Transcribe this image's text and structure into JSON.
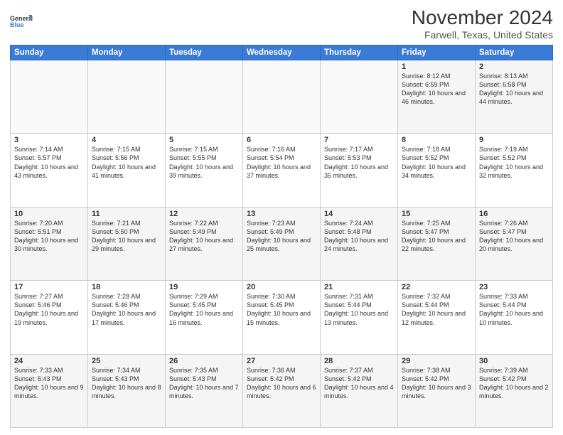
{
  "logo": {
    "line1": "General",
    "line2": "Blue"
  },
  "title": "November 2024",
  "subtitle": "Farwell, Texas, United States",
  "days_header": [
    "Sunday",
    "Monday",
    "Tuesday",
    "Wednesday",
    "Thursday",
    "Friday",
    "Saturday"
  ],
  "weeks": [
    [
      {
        "day": "",
        "info": ""
      },
      {
        "day": "",
        "info": ""
      },
      {
        "day": "",
        "info": ""
      },
      {
        "day": "",
        "info": ""
      },
      {
        "day": "",
        "info": ""
      },
      {
        "day": "1",
        "info": "Sunrise: 8:12 AM\nSunset: 6:59 PM\nDaylight: 10 hours\nand 46 minutes."
      },
      {
        "day": "2",
        "info": "Sunrise: 8:13 AM\nSunset: 6:58 PM\nDaylight: 10 hours\nand 44 minutes."
      }
    ],
    [
      {
        "day": "3",
        "info": "Sunrise: 7:14 AM\nSunset: 5:57 PM\nDaylight: 10 hours\nand 43 minutes."
      },
      {
        "day": "4",
        "info": "Sunrise: 7:15 AM\nSunset: 5:56 PM\nDaylight: 10 hours\nand 41 minutes."
      },
      {
        "day": "5",
        "info": "Sunrise: 7:15 AM\nSunset: 5:55 PM\nDaylight: 10 hours\nand 39 minutes."
      },
      {
        "day": "6",
        "info": "Sunrise: 7:16 AM\nSunset: 5:54 PM\nDaylight: 10 hours\nand 37 minutes."
      },
      {
        "day": "7",
        "info": "Sunrise: 7:17 AM\nSunset: 5:53 PM\nDaylight: 10 hours\nand 35 minutes."
      },
      {
        "day": "8",
        "info": "Sunrise: 7:18 AM\nSunset: 5:52 PM\nDaylight: 10 hours\nand 34 minutes."
      },
      {
        "day": "9",
        "info": "Sunrise: 7:19 AM\nSunset: 5:52 PM\nDaylight: 10 hours\nand 32 minutes."
      }
    ],
    [
      {
        "day": "10",
        "info": "Sunrise: 7:20 AM\nSunset: 5:51 PM\nDaylight: 10 hours\nand 30 minutes."
      },
      {
        "day": "11",
        "info": "Sunrise: 7:21 AM\nSunset: 5:50 PM\nDaylight: 10 hours\nand 29 minutes."
      },
      {
        "day": "12",
        "info": "Sunrise: 7:22 AM\nSunset: 5:49 PM\nDaylight: 10 hours\nand 27 minutes."
      },
      {
        "day": "13",
        "info": "Sunrise: 7:23 AM\nSunset: 5:49 PM\nDaylight: 10 hours\nand 25 minutes."
      },
      {
        "day": "14",
        "info": "Sunrise: 7:24 AM\nSunset: 5:48 PM\nDaylight: 10 hours\nand 24 minutes."
      },
      {
        "day": "15",
        "info": "Sunrise: 7:25 AM\nSunset: 5:47 PM\nDaylight: 10 hours\nand 22 minutes."
      },
      {
        "day": "16",
        "info": "Sunrise: 7:26 AM\nSunset: 5:47 PM\nDaylight: 10 hours\nand 20 minutes."
      }
    ],
    [
      {
        "day": "17",
        "info": "Sunrise: 7:27 AM\nSunset: 5:46 PM\nDaylight: 10 hours\nand 19 minutes."
      },
      {
        "day": "18",
        "info": "Sunrise: 7:28 AM\nSunset: 5:46 PM\nDaylight: 10 hours\nand 17 minutes."
      },
      {
        "day": "19",
        "info": "Sunrise: 7:29 AM\nSunset: 5:45 PM\nDaylight: 10 hours\nand 16 minutes."
      },
      {
        "day": "20",
        "info": "Sunrise: 7:30 AM\nSunset: 5:45 PM\nDaylight: 10 hours\nand 15 minutes."
      },
      {
        "day": "21",
        "info": "Sunrise: 7:31 AM\nSunset: 5:44 PM\nDaylight: 10 hours\nand 13 minutes."
      },
      {
        "day": "22",
        "info": "Sunrise: 7:32 AM\nSunset: 5:44 PM\nDaylight: 10 hours\nand 12 minutes."
      },
      {
        "day": "23",
        "info": "Sunrise: 7:33 AM\nSunset: 5:44 PM\nDaylight: 10 hours\nand 10 minutes."
      }
    ],
    [
      {
        "day": "24",
        "info": "Sunrise: 7:33 AM\nSunset: 5:43 PM\nDaylight: 10 hours\nand 9 minutes."
      },
      {
        "day": "25",
        "info": "Sunrise: 7:34 AM\nSunset: 5:43 PM\nDaylight: 10 hours\nand 8 minutes."
      },
      {
        "day": "26",
        "info": "Sunrise: 7:35 AM\nSunset: 5:43 PM\nDaylight: 10 hours\nand 7 minutes."
      },
      {
        "day": "27",
        "info": "Sunrise: 7:36 AM\nSunset: 5:42 PM\nDaylight: 10 hours\nand 6 minutes."
      },
      {
        "day": "28",
        "info": "Sunrise: 7:37 AM\nSunset: 5:42 PM\nDaylight: 10 hours\nand 4 minutes."
      },
      {
        "day": "29",
        "info": "Sunrise: 7:38 AM\nSunset: 5:42 PM\nDaylight: 10 hours\nand 3 minutes."
      },
      {
        "day": "30",
        "info": "Sunrise: 7:39 AM\nSunset: 5:42 PM\nDaylight: 10 hours\nand 2 minutes."
      }
    ]
  ]
}
